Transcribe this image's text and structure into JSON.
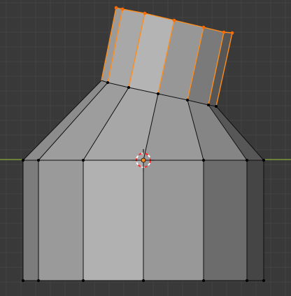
{
  "viewport": {
    "name": "3d-viewport",
    "background_color": "#393939",
    "grid_color": "#444444",
    "x_axis_color": "#7e9a3a",
    "y_axis_color": "#3b6fa0"
  },
  "mesh": {
    "name": "cylinder-mesh",
    "edge_color": "#101010",
    "vertex_color": "#000000",
    "selection_color": "#ff8c1a",
    "selected_vertex_color": "#ff6a00",
    "selected_part": "top-cap-extrusion"
  },
  "cursor_3d": {
    "name": "3d-cursor",
    "ring_red": "#ff2a2a",
    "ring_white": "#ffffff",
    "origin_color": "#ff8c1a"
  }
}
